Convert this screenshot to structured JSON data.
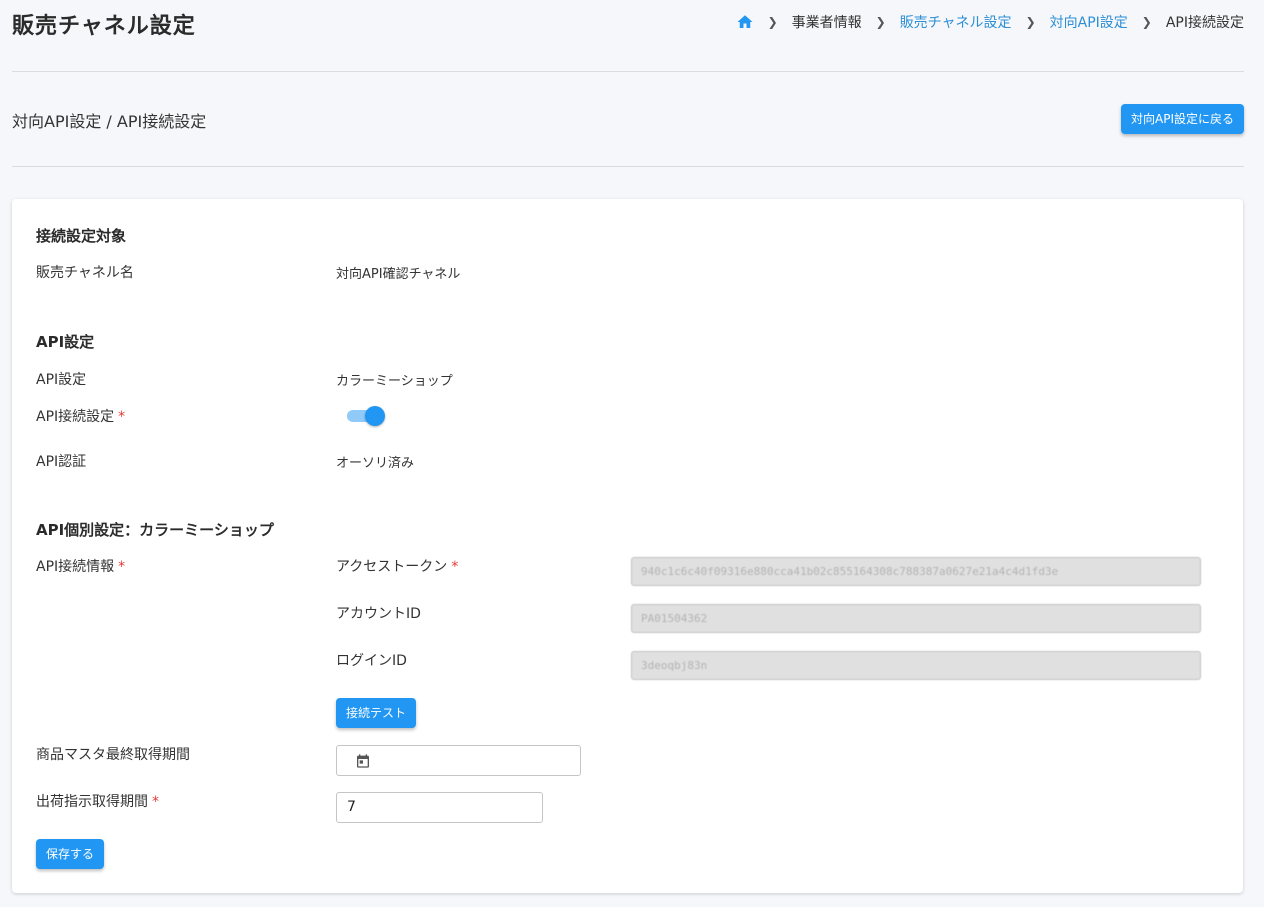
{
  "page_title": "販売チャネル設定",
  "breadcrumb": {
    "home_icon": "home-icon",
    "items": [
      "事業者情報",
      "販売チャネル設定",
      "対向API設定",
      "API接続設定"
    ],
    "separator": ">"
  },
  "subheading": "対向API設定 / API接続設定",
  "back_button": "対向API設定に戻る",
  "connection_target": {
    "section_title": "接続設定対象",
    "channel_name_label": "販売チャネル名",
    "channel_name_value": "対向API確認チャネル"
  },
  "api_settings": {
    "section_title": "API設定",
    "api_label": "API設定",
    "api_value": "カラーミーショップ",
    "connection_label": "API接続設定",
    "connection_required": "*",
    "connection_toggle_on": true,
    "auth_label": "API認証",
    "auth_value": "オーソリ済み"
  },
  "individual_settings": {
    "section_title": "API個別設定：カラーミーショップ",
    "connection_info_label": "API接続情報",
    "connection_info_required": "*",
    "access_token_label": "アクセストークン",
    "access_token_required": "*",
    "access_token_value": "940c1c6c40f09316e880cca41b02c855164308c788387a0627e21a4c4d1fd3e",
    "account_id_label": "アカウントID",
    "account_id_value": "PA01504362",
    "login_id_label": "ログインID",
    "login_id_value": "3deoqbj83n",
    "test_button": "接続テスト",
    "product_master_label": "商品マスタ最終取得期間",
    "calendar_icon": "calendar-icon",
    "product_master_value": "",
    "shipping_label": "出荷指示取得期間",
    "shipping_required": "*",
    "shipping_value": "7",
    "save_button": "保存する"
  },
  "colors": {
    "accent": "#2196f3",
    "link": "#2d8fd5",
    "required": "#e53935",
    "background": "#f5f7fb"
  }
}
